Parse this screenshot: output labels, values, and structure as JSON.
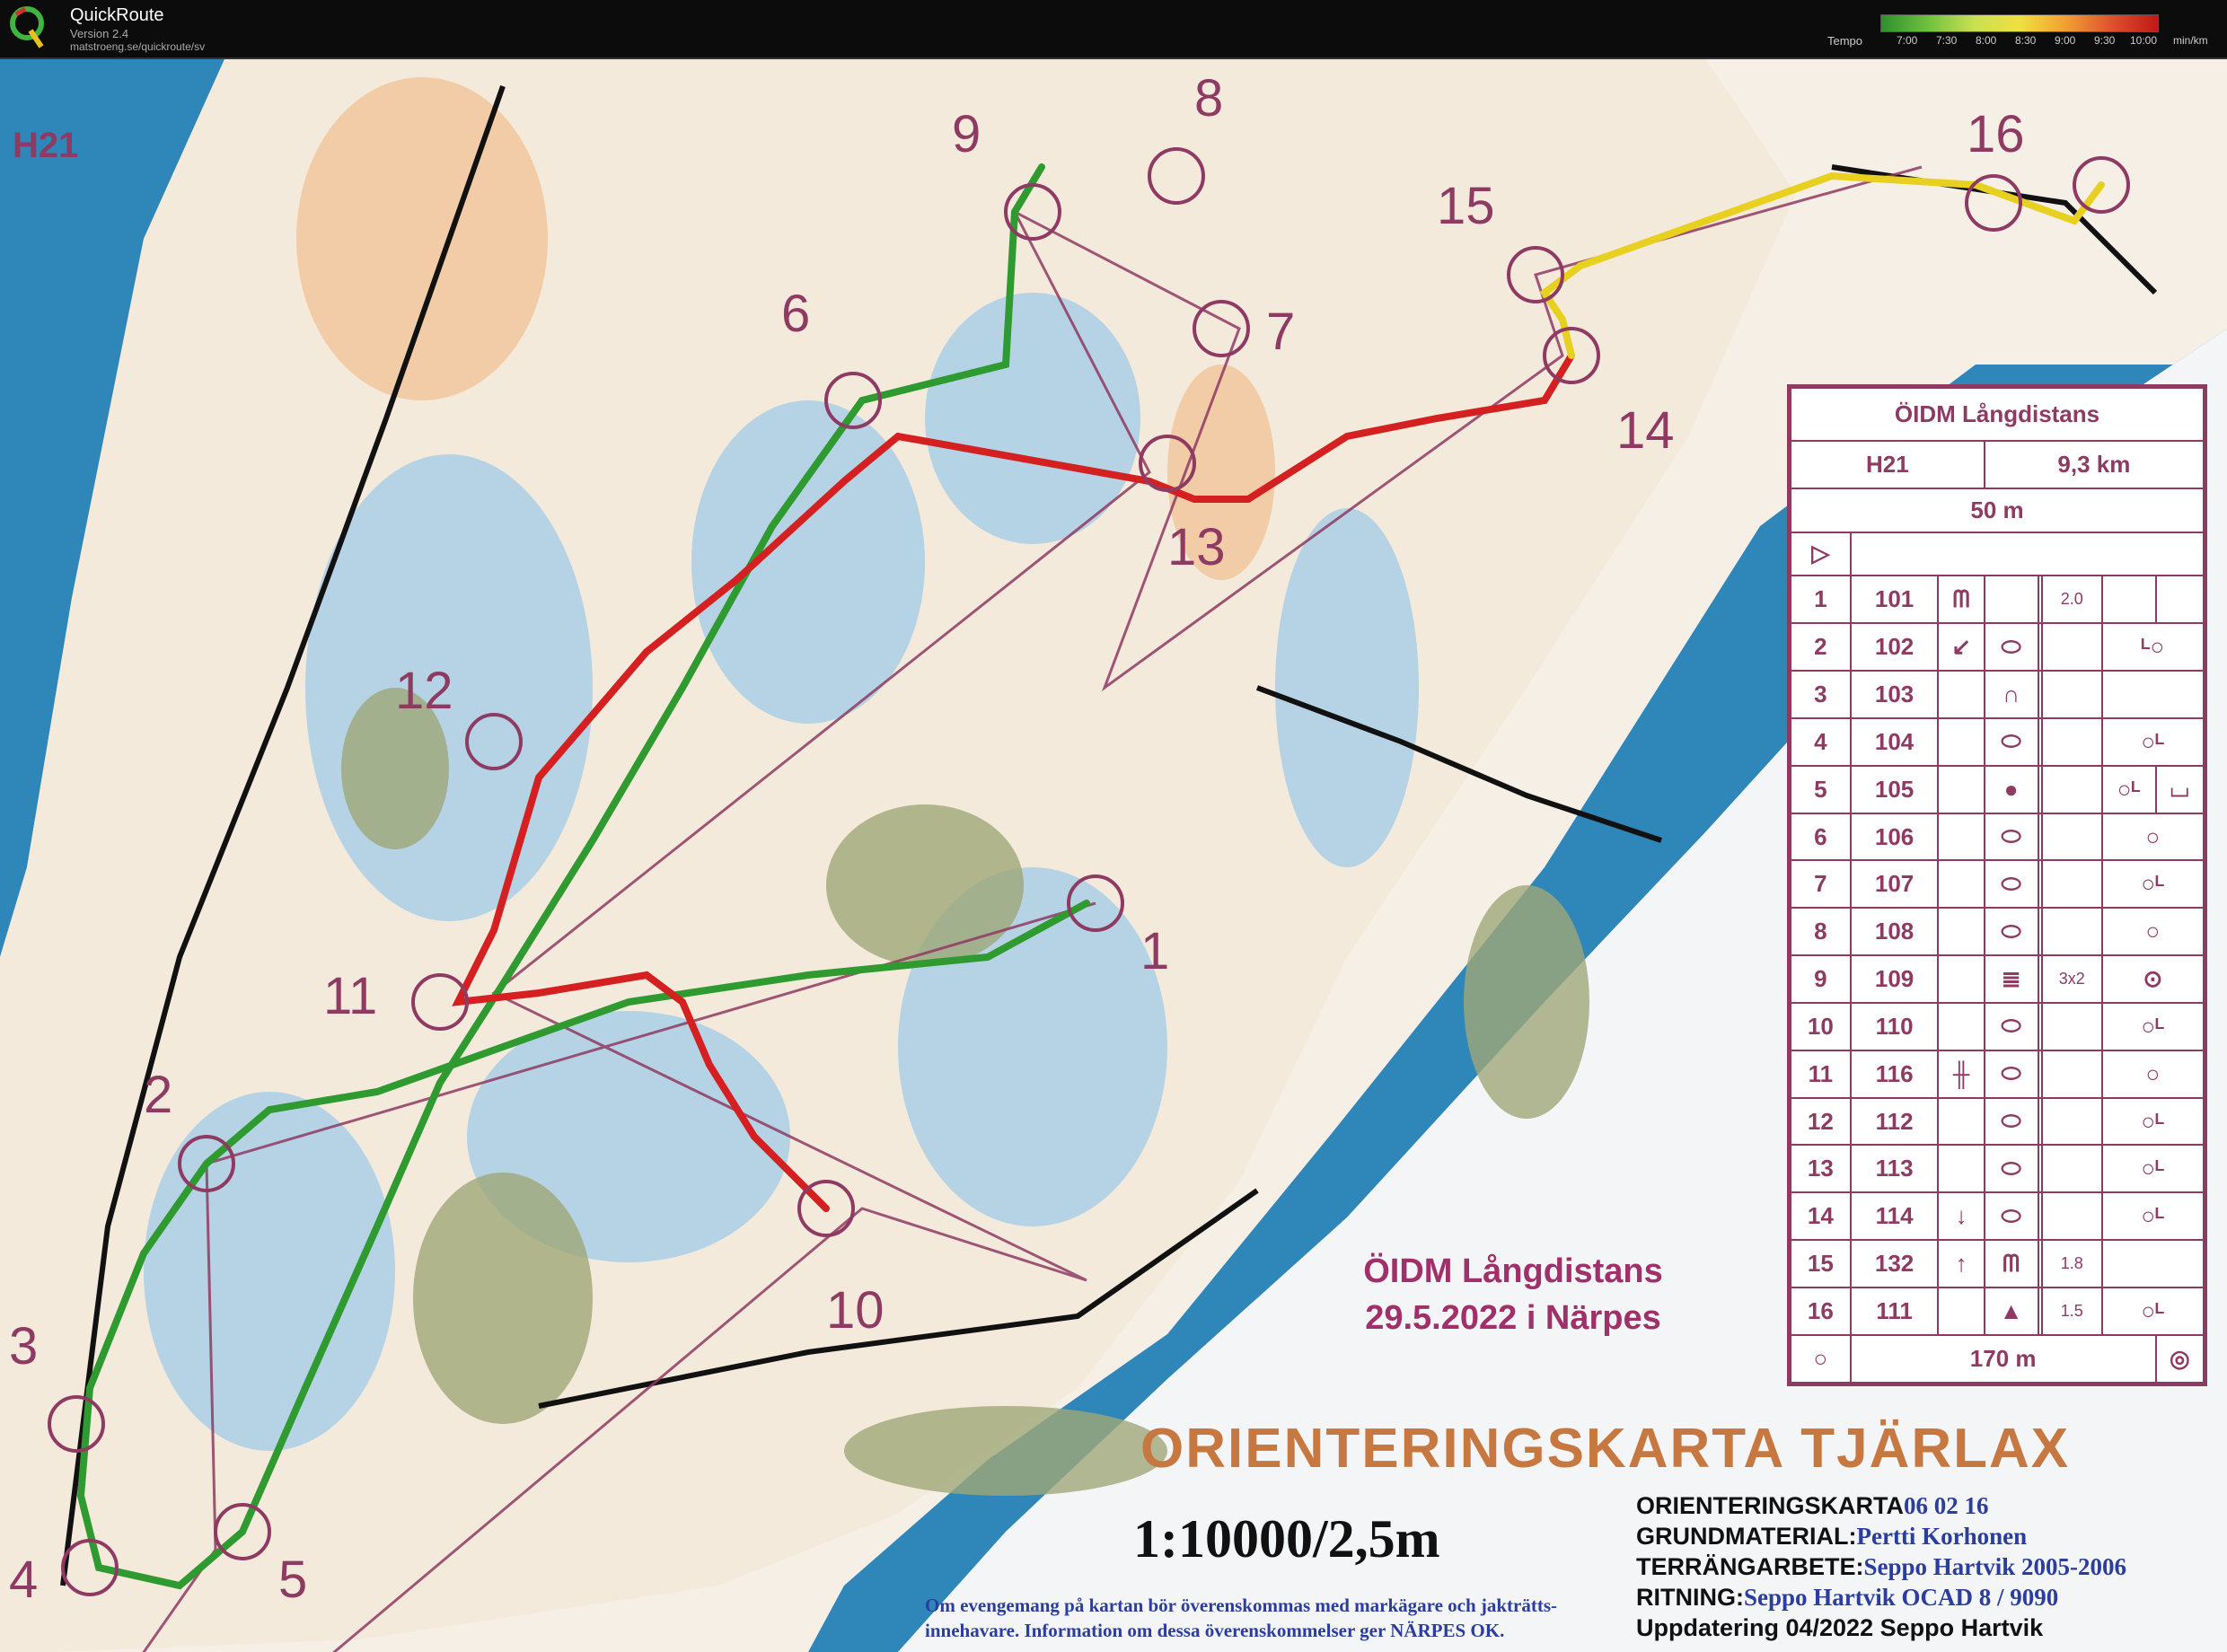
{
  "app": {
    "name": "QuickRoute",
    "version": "Version 2.4",
    "url": "matstroeng.se/quickroute/sv"
  },
  "tempo": {
    "label": "Tempo",
    "ticks": [
      "7:00",
      "7:30",
      "8:00",
      "8:30",
      "9:00",
      "9:30",
      "10:00"
    ],
    "unit": "min/km",
    "colors": [
      "#2f8f2f",
      "#6fc040",
      "#c8e050",
      "#f0e040",
      "#f0a030",
      "#e05030",
      "#c01818"
    ]
  },
  "map": {
    "class_label": "H21",
    "controls": [
      "1",
      "2",
      "3",
      "4",
      "5",
      "6",
      "7",
      "8",
      "9",
      "10",
      "11",
      "12",
      "13",
      "14",
      "15",
      "16"
    ],
    "event_title_line1": "ÖIDM Långdistans",
    "event_title_line2": "29.5.2022 i Närpes",
    "big_title": "ORIENTERINGSKARTA TJÄRLAX",
    "scale": "1:10000/2,5m",
    "info": [
      {
        "label": "ORIENTERINGSKARTA",
        "value": "06 02 16"
      },
      {
        "label": "GRUNDMATERIAL:",
        "value": "Pertti Korhonen"
      },
      {
        "label": "TERRÄNGARBETE:",
        "value": "Seppo Hartvik 2005-2006"
      },
      {
        "label": "RITNING:",
        "value": "Seppo Hartvik  OCAD 8 / 9090"
      },
      {
        "label": "Uppdatering 04/2022  Seppo Hartvik",
        "value": ""
      }
    ],
    "notice_line1": "Om evengemang på kartan bör överenskommas med markägare och jakträtts-",
    "notice_line2": "innehavare. Information om dessa överenskommelser ger NÄRPES OK.",
    "colors": {
      "water": "#2f86b8",
      "route_fast": "#2f9a2f",
      "route_slow": "#d42020",
      "course": "#8e3a62",
      "rock": "#c77840"
    }
  },
  "description": {
    "title": "ÖIDM Långdistans",
    "class": "H21",
    "length": "9,3 km",
    "start_tape": "50 m",
    "finish_tape": "170 m",
    "rows": [
      {
        "n": "1",
        "code": "101",
        "extra": "2.0"
      },
      {
        "n": "2",
        "code": "102",
        "extra": ""
      },
      {
        "n": "3",
        "code": "103",
        "extra": ""
      },
      {
        "n": "4",
        "code": "104",
        "extra": ""
      },
      {
        "n": "5",
        "code": "105",
        "extra": ""
      },
      {
        "n": "6",
        "code": "106",
        "extra": ""
      },
      {
        "n": "7",
        "code": "107",
        "extra": ""
      },
      {
        "n": "8",
        "code": "108",
        "extra": ""
      },
      {
        "n": "9",
        "code": "109",
        "extra": "3x2"
      },
      {
        "n": "10",
        "code": "110",
        "extra": ""
      },
      {
        "n": "11",
        "code": "116",
        "extra": ""
      },
      {
        "n": "12",
        "code": "112",
        "extra": ""
      },
      {
        "n": "13",
        "code": "113",
        "extra": ""
      },
      {
        "n": "14",
        "code": "114",
        "extra": ""
      },
      {
        "n": "15",
        "code": "132",
        "extra": "1.8"
      },
      {
        "n": "16",
        "code": "111",
        "extra": "1.5"
      }
    ]
  }
}
